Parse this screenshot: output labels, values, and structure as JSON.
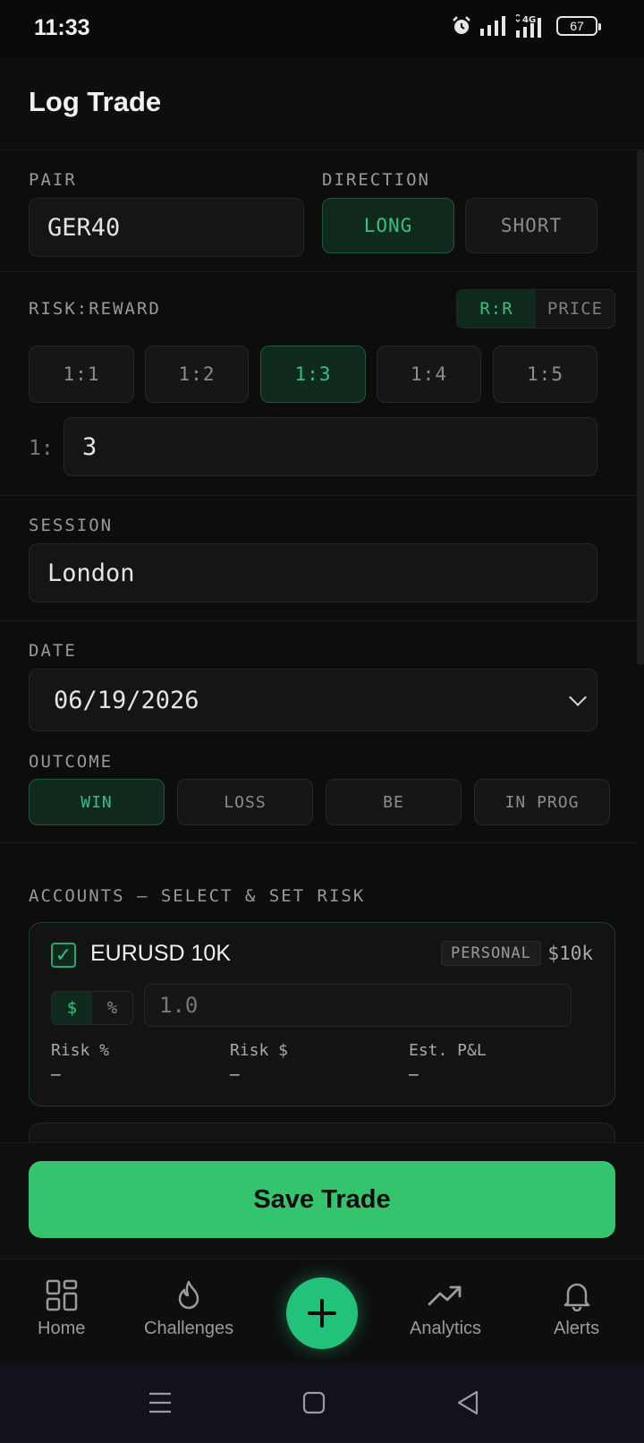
{
  "status": {
    "time": "11:33",
    "battery": "67"
  },
  "header": {
    "title": "Log Trade"
  },
  "pair": {
    "label": "PAIR",
    "value": "GER40"
  },
  "direction": {
    "label": "DIRECTION",
    "long": "LONG",
    "short": "SHORT",
    "selected": "LONG"
  },
  "risk_reward": {
    "label": "RISK:REWARD",
    "mode_rr": "R:R",
    "mode_price": "PRICE",
    "presets": [
      "1:1",
      "1:2",
      "1:3",
      "1:4",
      "1:5"
    ],
    "selected": "1:3",
    "prefix": "1:",
    "value": "3"
  },
  "session": {
    "label": "SESSION",
    "value": "London"
  },
  "date": {
    "label": "DATE",
    "value": "06/19/2026"
  },
  "outcome": {
    "label": "OUTCOME",
    "options": [
      "WIN",
      "LOSS",
      "BE",
      "IN PROG"
    ],
    "selected": "WIN"
  },
  "accounts": {
    "label": "ACCOUNTS — SELECT & SET RISK",
    "items": [
      {
        "name": "EURUSD 10K",
        "badge": "PERSONAL",
        "size": "$10k",
        "unit_dollar": "$",
        "unit_percent": "%",
        "risk_placeholder": "1.0",
        "risk_pct_label": "Risk %",
        "risk_pct_value": "—",
        "risk_usd_label": "Risk $",
        "risk_usd_value": "—",
        "pnl_label": "Est. P&L",
        "pnl_value": "—"
      }
    ]
  },
  "save_label": "Save Trade",
  "nav": {
    "home": "Home",
    "challenges": "Challenges",
    "analytics": "Analytics",
    "alerts": "Alerts"
  },
  "colors": {
    "accent": "#34c46d",
    "accent_text": "#34c27d",
    "background": "#0b0b0b"
  }
}
